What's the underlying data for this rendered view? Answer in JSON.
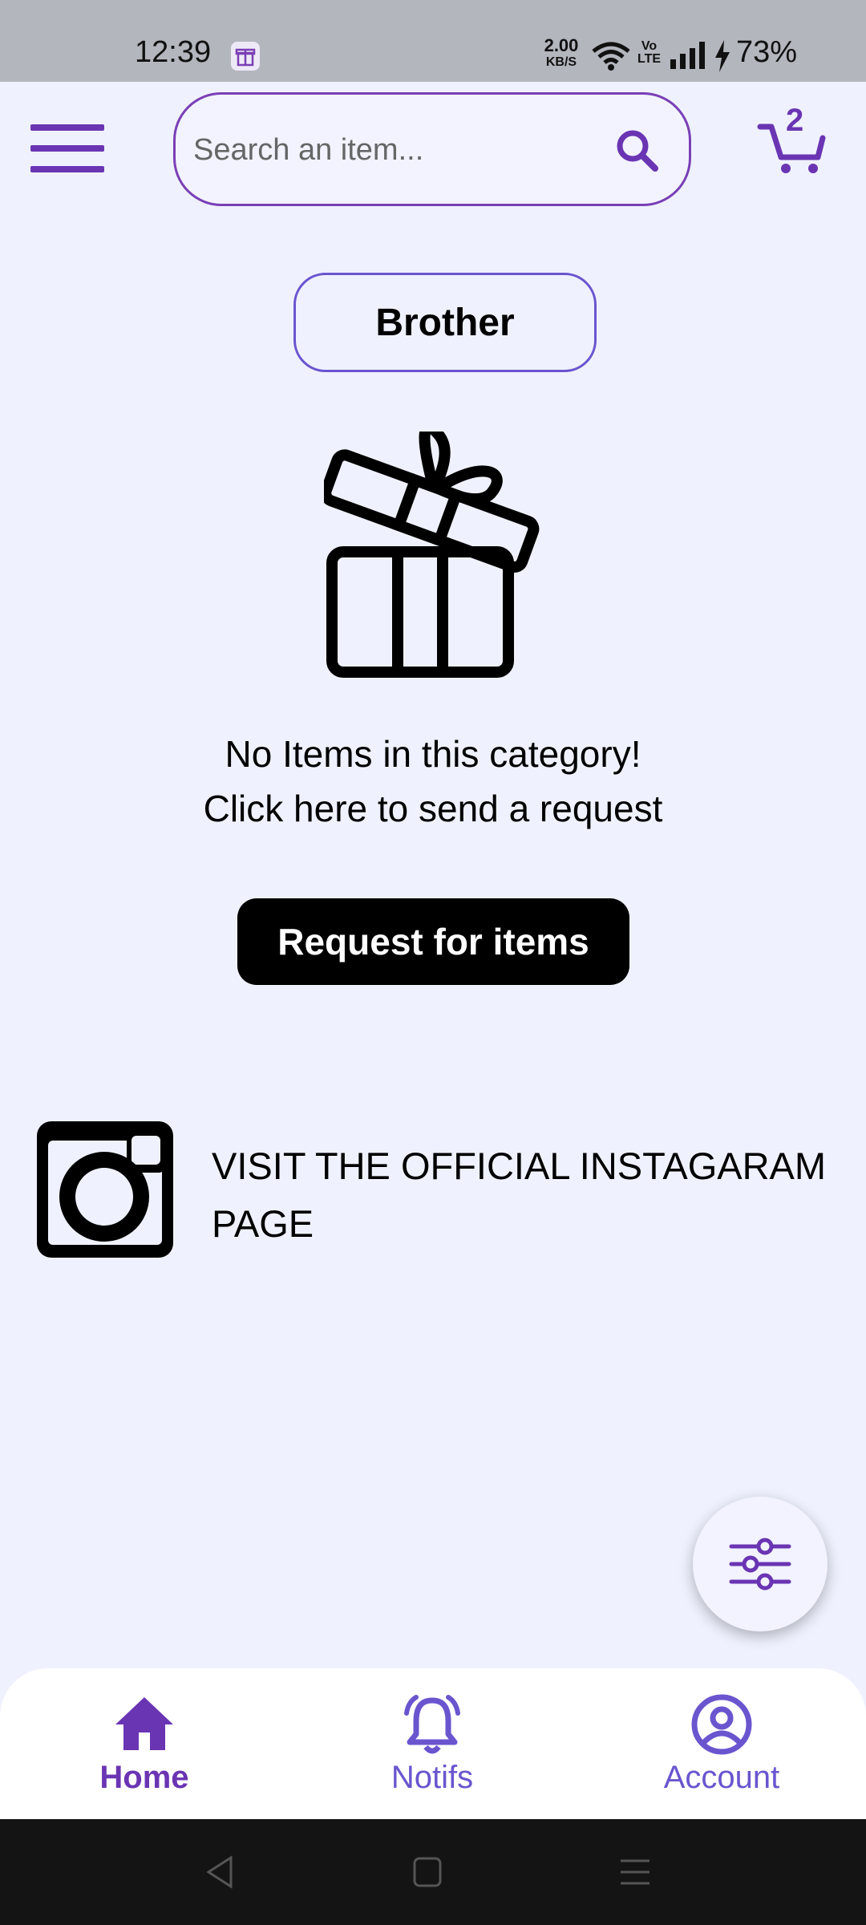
{
  "status_bar": {
    "time": "12:39",
    "net_speed_value": "2.00",
    "net_speed_unit": "KB/S",
    "volte_top": "Vo",
    "volte_bottom": "LTE",
    "battery": "73%"
  },
  "header": {
    "search_placeholder": "Search an item...",
    "cart_count": "2"
  },
  "category": {
    "label": "Brother"
  },
  "empty_state": {
    "line1": "No Items in this category!",
    "line2": "Click here to send a request"
  },
  "request_button": {
    "label": "Request for items"
  },
  "instagram": {
    "text": "VISIT THE OFFICIAL INSTAGARAM PAGE"
  },
  "bottom_nav": {
    "items": [
      {
        "label": "Home",
        "icon": "home-icon",
        "active": true
      },
      {
        "label": "Notifs",
        "icon": "bell-icon",
        "active": false
      },
      {
        "label": "Account",
        "icon": "account-icon",
        "active": false
      }
    ]
  },
  "colors": {
    "background": "#eff2fe",
    "primary_purple": "#6a35b3",
    "accent_indigo": "#6a55cf",
    "button_black": "#000000"
  }
}
